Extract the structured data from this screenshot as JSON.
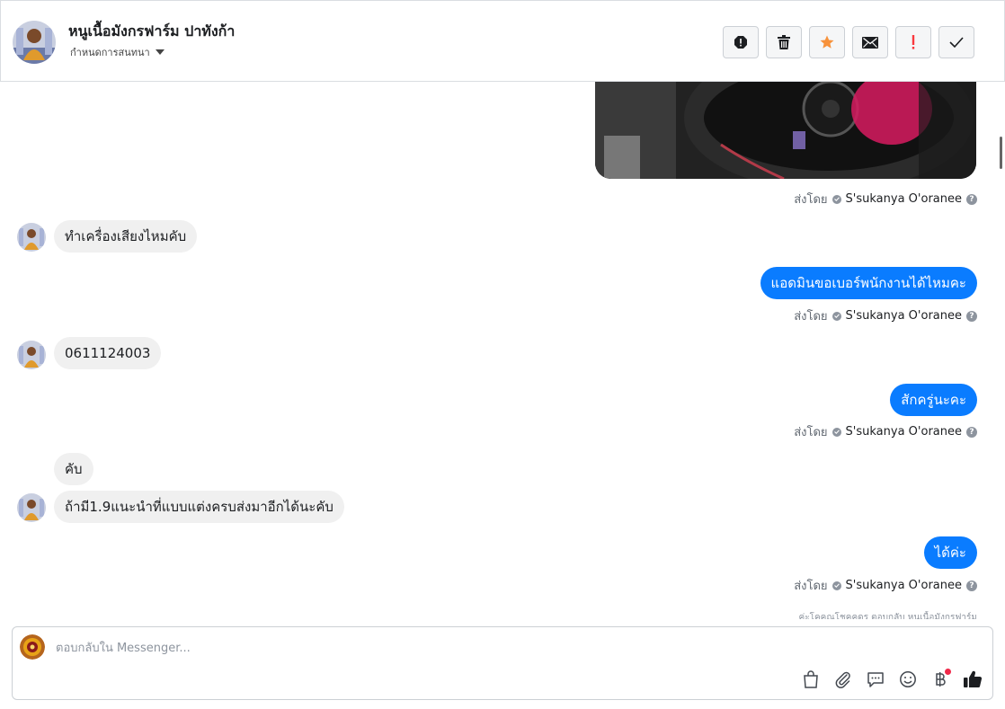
{
  "header": {
    "title": "หนูเนื้อมังกรฟาร์ม ปาทังก้า",
    "subtitle": "กำหนดการสนทนา",
    "actions": [
      {
        "name": "exclamation-circle-icon"
      },
      {
        "name": "trash-icon"
      },
      {
        "name": "star-icon",
        "color": "#f7923b"
      },
      {
        "name": "envelope-icon"
      },
      {
        "name": "important-icon",
        "color": "#fa383e"
      },
      {
        "name": "checkmark-icon"
      }
    ]
  },
  "thread": {
    "sent_by_label": "ส่งโดย",
    "sender_name": "S'sukanya O'oranee",
    "help": "?",
    "messages": [
      {
        "direction": "out",
        "type": "image"
      },
      {
        "direction": "in",
        "text": "ทำเครื่องเสียงไหมคับ"
      },
      {
        "direction": "out",
        "text": "แอดมินขอเบอร์พนักงานได้ไหมคะ"
      },
      {
        "direction": "in",
        "text": "0611124003"
      },
      {
        "direction": "out",
        "text": "สักครู่นะคะ"
      },
      {
        "direction": "in",
        "text": "คับ"
      },
      {
        "direction": "in",
        "text": "ถ้ามี1.9แนะนำที่แบบแต่งครบส่งมาอีกได้นะคับ"
      },
      {
        "direction": "out",
        "text": "ได้ค่ะ"
      }
    ],
    "truncated_note": "ค่ะโคคุณโชคคดร ตอบกลับ หนูเนื้อมังกรฟาร์ม"
  },
  "composer": {
    "placeholder": "ตอบกลับใน Messenger...",
    "tools": [
      "shopping-bag-icon",
      "paperclip-icon",
      "chat-bubble-icon",
      "smiley-icon",
      "baht-icon",
      "thumbs-up-icon"
    ]
  },
  "colors": {
    "accent": "#0a7cff",
    "incoming_bubble": "#f0f0f0",
    "star": "#f7923b",
    "important": "#fa383e"
  }
}
